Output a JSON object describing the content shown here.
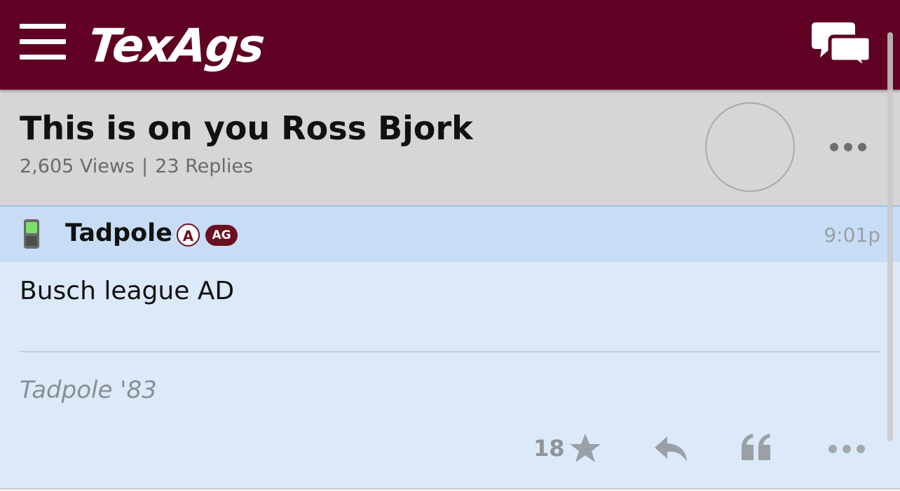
{
  "colors": {
    "header_bg": "#5f0024",
    "thread_header_bg": "#d6d6d6",
    "post_bg": "#dbe9f9",
    "post_header_bg": "#c7ddf6",
    "badge_maroon": "#6b1020",
    "action_gray": "#9aa0a6"
  },
  "header": {
    "logo_text": "TexAgs",
    "menu_icon": "hamburger-menu-icon",
    "chat_icon": "chat-bubbles-icon"
  },
  "thread": {
    "title": "This is on you Ross Bjork",
    "views": "2,605 Views",
    "separator": "|",
    "replies": "23 Replies",
    "more_icon": "more-dots-icon"
  },
  "post": {
    "device_icon": "mobile-phone-icon",
    "username": "Tadpole",
    "badge_a": "A",
    "badge_ag": "AG",
    "time": "9:01p",
    "body": "Busch league AD",
    "signature": "Tadpole '83",
    "actions": {
      "star_count": "18",
      "star_icon": "star-icon",
      "reply_icon": "reply-icon",
      "quote_icon": "quote-icon",
      "more_icon": "more-dots-icon"
    }
  }
}
